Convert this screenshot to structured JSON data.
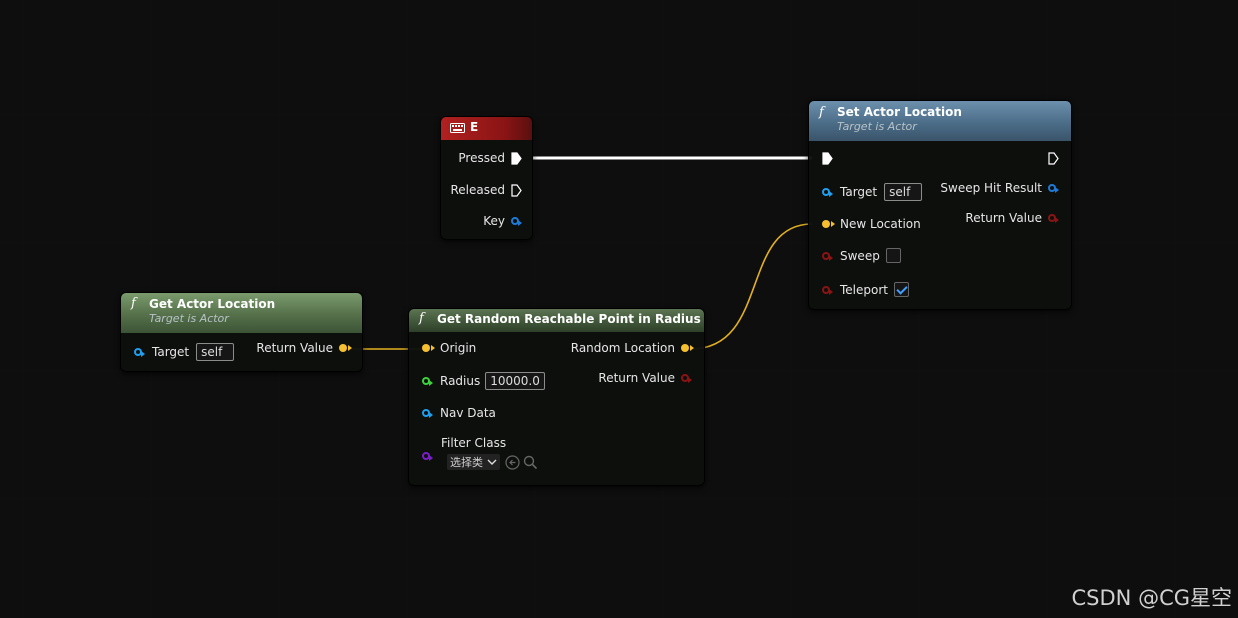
{
  "colors": {
    "exec": "#ffffff",
    "object_pin": "#1ea0f0",
    "vector_pin": "#f5c030",
    "float_pin": "#3cd23c",
    "bool_pin": "#9a1414",
    "class_pin": "#7a1fc8",
    "wire_vector": "#e3b020"
  },
  "key_node": {
    "icon": "keyboard-icon",
    "title": "E",
    "pins": {
      "pressed": "Pressed",
      "released": "Released",
      "key": "Key"
    }
  },
  "set_location_node": {
    "icon": "function-icon",
    "title": "Set Actor Location",
    "subtitle": "Target is Actor",
    "target_label": "Target",
    "target_value": "self",
    "new_location_label": "New Location",
    "sweep_label": "Sweep",
    "sweep_checked": false,
    "teleport_label": "Teleport",
    "teleport_checked": true,
    "sweep_hit_result_label": "Sweep Hit Result",
    "return_value_label": "Return Value"
  },
  "get_location_node": {
    "icon": "function-icon",
    "title": "Get Actor Location",
    "subtitle": "Target is Actor",
    "target_label": "Target",
    "target_value": "self",
    "return_value_label": "Return Value"
  },
  "random_point_node": {
    "icon": "function-icon",
    "title": "Get Random Reachable Point in Radius",
    "origin_label": "Origin",
    "radius_label": "Radius",
    "radius_value": "10000.0",
    "nav_data_label": "Nav Data",
    "filter_class_label": "Filter Class",
    "filter_class_select": "选择类",
    "random_location_label": "Random Location",
    "return_value_label": "Return Value"
  },
  "watermark": "CSDN @CG星空"
}
